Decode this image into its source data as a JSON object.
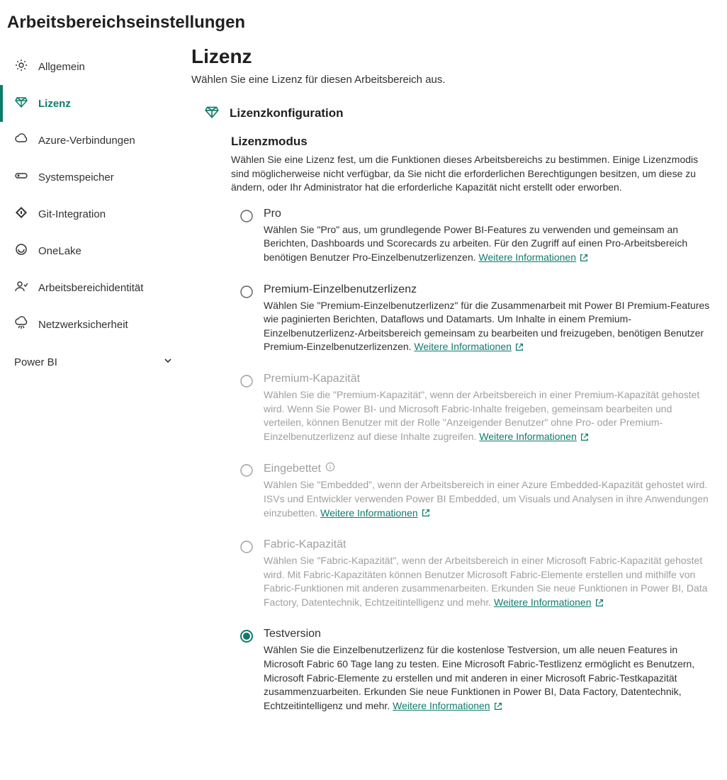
{
  "page_title": "Arbeitsbereichseinstellungen",
  "sidebar": {
    "items": [
      {
        "label": "Allgemein",
        "icon": "gear-icon"
      },
      {
        "label": "Lizenz",
        "icon": "diamond-icon",
        "active": true
      },
      {
        "label": "Azure-Verbindungen",
        "icon": "cloud-icon"
      },
      {
        "label": "Systemspeicher",
        "icon": "storage-icon"
      },
      {
        "label": "Git-Integration",
        "icon": "git-icon"
      },
      {
        "label": "OneLake",
        "icon": "onelake-icon"
      },
      {
        "label": "Arbeitsbereichidentität",
        "icon": "identity-icon"
      },
      {
        "label": "Netzwerksicherheit",
        "icon": "network-icon"
      }
    ],
    "group_label": "Power BI"
  },
  "main": {
    "heading": "Lizenz",
    "subtitle": "Wählen Sie eine Lizenz für diesen Arbeitsbereich aus.",
    "config_title": "Lizenzkonfiguration",
    "mode_heading": "Lizenzmodus",
    "mode_desc": "Wählen Sie eine Lizenz fest, um die Funktionen dieses Arbeitsbereichs zu bestimmen. Einige Lizenzmodis sind möglicherweise nicht verfügbar, da Sie nicht die erforderlichen Berechtigungen besitzen, um diese zu ändern, oder Ihr Administrator hat die erforderliche Kapazität nicht erstellt oder erworben.",
    "learn_more": "Weitere Informationen",
    "options": [
      {
        "key": "pro",
        "title": "Pro",
        "desc": "Wählen Sie \"Pro\" aus, um grundlegende Power BI-Features zu verwenden und gemeinsam an Berichten, Dashboards und Scorecards zu arbeiten. Für den Zugriff auf einen Pro-Arbeitsbereich benötigen Benutzer Pro-Einzelbenutzerlizenzen.",
        "disabled": false,
        "selected": false
      },
      {
        "key": "ppu",
        "title": "Premium-Einzelbenutzerlizenz",
        "desc": "Wählen Sie \"Premium-Einzelbenutzerlizenz\" für die Zusammenarbeit mit Power BI Premium-Features wie paginierten Berichten, Dataflows und Datamarts. Um Inhalte in einem Premium-Einzelbenutzerlizenz-Arbeitsbereich gemeinsam zu bearbeiten und freizugeben, benötigen Benutzer Premium-Einzelbenutzerlizenzen.",
        "disabled": false,
        "selected": false
      },
      {
        "key": "premium-capacity",
        "title": "Premium-Kapazität",
        "desc": "Wählen Sie die \"Premium-Kapazität\", wenn der Arbeitsbereich in einer Premium-Kapazität gehostet wird. Wenn Sie Power BI- und Microsoft Fabric-Inhalte freigeben, gemeinsam bearbeiten und verteilen, können Benutzer mit der Rolle \"Anzeigender Benutzer\" ohne Pro- oder Premium-Einzelbenutzerlizenz auf diese Inhalte zugreifen.",
        "disabled": true,
        "selected": false
      },
      {
        "key": "embedded",
        "title": "Eingebettet",
        "desc": "Wählen Sie \"Embedded\", wenn der Arbeitsbereich in einer Azure Embedded-Kapazität gehostet wird. ISVs und Entwickler verwenden Power BI Embedded, um Visuals und Analysen in ihre Anwendungen einzubetten.",
        "disabled": true,
        "selected": false,
        "info": true
      },
      {
        "key": "fabric-capacity",
        "title": "Fabric-Kapazität",
        "desc": "Wählen Sie \"Fabric-Kapazität\", wenn der Arbeitsbereich in einer Microsoft Fabric-Kapazität gehostet wird. Mit Fabric-Kapazitäten können Benutzer Microsoft Fabric-Elemente erstellen und mithilfe von Fabric-Funktionen mit anderen zusammenarbeiten. Erkunden Sie neue Funktionen in Power BI, Data Factory, Datentechnik, Echtzeitintelligenz und mehr.",
        "disabled": true,
        "selected": false
      },
      {
        "key": "trial",
        "title": "Testversion",
        "desc": "Wählen Sie die Einzelbenutzerlizenz für die kostenlose Testversion, um alle neuen Features in Microsoft Fabric 60 Tage lang zu testen. Eine Microsoft Fabric-Testlizenz ermöglicht es Benutzern, Microsoft Fabric-Elemente zu erstellen und mit anderen in einer Microsoft Fabric-Testkapazität zusammenzuarbeiten. Erkunden Sie neue Funktionen in Power BI, Data Factory, Datentechnik, Echtzeitintelligenz und mehr.",
        "disabled": false,
        "selected": true
      }
    ]
  }
}
